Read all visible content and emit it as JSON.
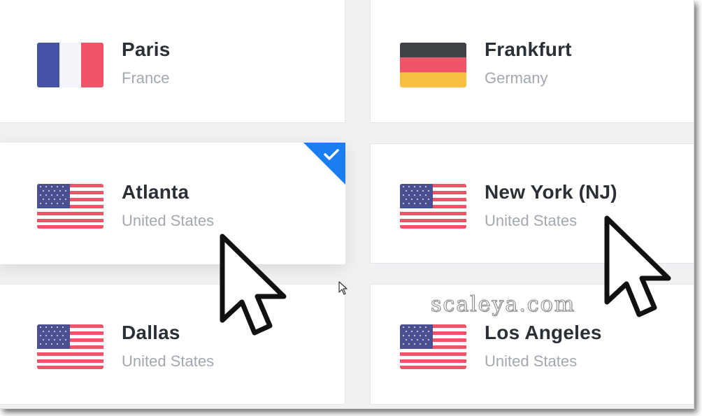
{
  "locations": [
    {
      "city": "Paris",
      "country": "France",
      "flag": "france-flag",
      "selected": false
    },
    {
      "city": "Frankfurt",
      "country": "Germany",
      "flag": "germany-flag",
      "selected": false
    },
    {
      "city": "Atlanta",
      "country": "United States",
      "flag": "us-flag",
      "selected": true
    },
    {
      "city": "New York (NJ)",
      "country": "United States",
      "flag": "us-flag",
      "selected": false
    },
    {
      "city": "Dallas",
      "country": "United States",
      "flag": "us-flag",
      "selected": false
    },
    {
      "city": "Los Angeles",
      "country": "United States",
      "flag": "us-flag",
      "selected": false
    }
  ],
  "selected_badge": {
    "icon": "check-icon",
    "color": "#1a7ef2"
  },
  "watermark": "scaleya.com",
  "colors": {
    "france_blue": "#4453a5",
    "france_white": "#f4f5fa",
    "france_red": "#f05468",
    "germany_black": "#3f4347",
    "germany_red": "#f05468",
    "germany_gold": "#f7bf42",
    "us_red": "#f05468",
    "us_blue": "#4a4f8f"
  }
}
